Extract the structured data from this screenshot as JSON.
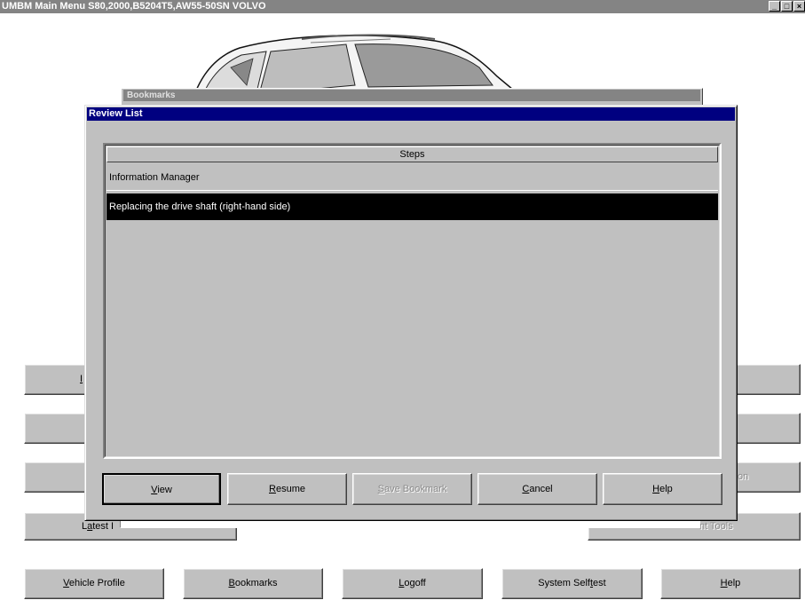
{
  "window": {
    "title": "UMBM Main Menu S80,2000,B5204T5,AW55-50SN VOLVO",
    "controls": [
      "_",
      "□",
      "×"
    ]
  },
  "bookmarks_window": {
    "title": "Bookmarks"
  },
  "dialog": {
    "title": "Review List",
    "list": {
      "column_header": "Steps",
      "rows": [
        {
          "label": "Information Manager",
          "selected": false
        },
        {
          "label": "Replacing the drive shaft (right-hand side)",
          "selected": true
        }
      ]
    },
    "buttons": {
      "view": {
        "prefix": "",
        "key": "V",
        "rest": "iew"
      },
      "resume": {
        "prefix": "",
        "key": "R",
        "rest": "esume"
      },
      "save_bookmark": {
        "prefix": "",
        "key": "S",
        "rest": "ave Bookmark"
      },
      "cancel": {
        "prefix": "",
        "key": "C",
        "rest": "ancel"
      },
      "help": {
        "prefix": "",
        "key": "H",
        "rest": "elp"
      }
    }
  },
  "main_menu": {
    "partial_left_1": "I",
    "partial_right_3": "on",
    "latest_prefix": "L",
    "latest_key": "a",
    "latest_rest": "test I",
    "partial_right_4": "nt Tools",
    "bottom": {
      "vehicle_profile": {
        "prefix": "",
        "key": "V",
        "rest": "ehicle Profile"
      },
      "bookmarks": {
        "prefix": "",
        "key": "B",
        "rest": "ookmarks"
      },
      "logoff": {
        "prefix": "",
        "key": "L",
        "rest": "ogoff"
      },
      "system_selftest": {
        "prefix": "System Self",
        "key": "t",
        "rest": "est"
      },
      "help": {
        "prefix": "",
        "key": "H",
        "rest": "elp"
      }
    }
  },
  "colors": {
    "title_active": "#000080",
    "title_inactive": "#848484",
    "face": "#c0c0c0",
    "selection": "#000000"
  }
}
